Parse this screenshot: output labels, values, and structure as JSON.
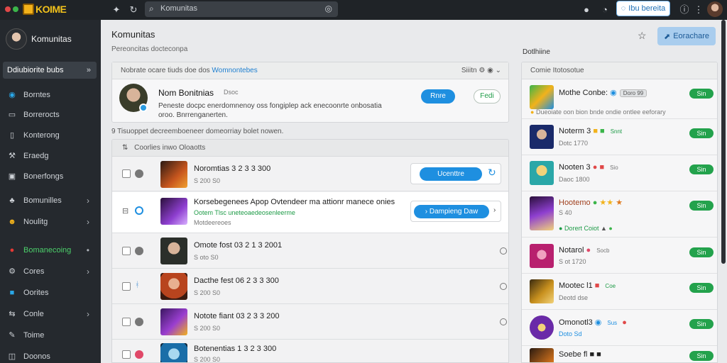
{
  "app": {
    "logo_text": "KOIME"
  },
  "topbar": {
    "search_text": "Komunitas",
    "button_label": "Ibu bereita",
    "icons": [
      "star-icon",
      "emoji-icon",
      "search-icon",
      "notification-icon",
      "settings-icon"
    ]
  },
  "sidebar": {
    "profile_name": "Komunitas",
    "active_label": "Ddiubiorite bubs",
    "items": [
      {
        "label": "Borntes",
        "icon": "layers-icon"
      },
      {
        "label": "Borrerocts",
        "icon": "monitor-icon"
      },
      {
        "label": "Konterong",
        "icon": "book-icon"
      },
      {
        "label": "Eraedg",
        "icon": "tools-icon"
      },
      {
        "label": "Bonerfongs",
        "icon": "image-icon"
      },
      {
        "label": "Bomunilles",
        "icon": "group-icon"
      },
      {
        "label": "Noulitg",
        "icon": "smile-icon"
      },
      {
        "label": "Bomanecoing",
        "icon": "heart-icon"
      },
      {
        "label": "Cores",
        "icon": "gear-icon"
      },
      {
        "label": "Oorites",
        "icon": "blue-square-icon"
      },
      {
        "label": "Conle",
        "icon": "arrows-icon"
      },
      {
        "label": "Toime",
        "icon": "pen-icon"
      },
      {
        "label": "Doonos",
        "icon": "chat-icon"
      }
    ]
  },
  "main": {
    "title": "Komunitas",
    "subtitle": "Pereoncitas docteconpa",
    "primary_button": "Eorachare",
    "panel_a": {
      "head_text": "Nobrate ocare tiuds doe dos",
      "head_highlight": "Womnontebes",
      "tools": "Siiitn",
      "name": "Nom Bonitnias",
      "tag": "Dsoc",
      "description": "Peneste docpc enerdomnenoy oss fongiplep ack enecoonrte onbosatia oroo. Bnrrenganerten.",
      "btn_blue": "Rnre",
      "btn_outline": "Fedi"
    },
    "section_note": "9 Tisuoppet decreemboeneer domeorriay bolet nowen.",
    "panel_b": {
      "head_text": "Coorlies inwo Oloaotts",
      "rows": [
        {
          "title": "Noromtias 3 2 3 3 300",
          "meta": "S 200 S0",
          "action": "Ucenttre"
        },
        {
          "title": "Korsebegenees Apop Ovtendeer ma attionr manece onies",
          "green": "Ootem Tlsc uneteoaedeosenleerme",
          "meta": "Motdeereoes",
          "action": "Dampieng Daw"
        },
        {
          "title": "Omote fost 03 2 1 3 2001",
          "meta": "S oto S0"
        },
        {
          "title": "Dacthe fest 06 2 3 3 300",
          "meta": "S 200 S0"
        },
        {
          "title": "Notote fiant 03 2 3 3 200",
          "meta": "S 200 S0"
        },
        {
          "title": "Botenentias 1 3 2 3 300",
          "meta": "S 200 S0"
        }
      ]
    }
  },
  "right": {
    "title": "Dotlhiine",
    "head_text": "Comie Itotosotue",
    "items": [
      {
        "name": "Mothe Conbe:",
        "tag": "Doro 99",
        "meta": "Dueoiate oon bion bnde ondie ontlee eeforary",
        "btn": "Sin"
      },
      {
        "name": "Noterm 3",
        "tag": "Snnt",
        "meta": "Dotc 1770",
        "btn": "Sin"
      },
      {
        "name": "Nooten 3",
        "tag": "Sio",
        "meta": "Daoc 1800",
        "btn": "Sin"
      },
      {
        "name": "Hootemo",
        "tag": "",
        "meta": "S 40",
        "sub": "Dorert Coiot",
        "btn": "Sin"
      },
      {
        "name": "Notarol",
        "tag": "Socb",
        "meta": "S ot 1720",
        "btn": "Sin"
      },
      {
        "name": "Mootec l1",
        "tag": "Coe",
        "meta": "Deotd dse",
        "btn": "Sin"
      },
      {
        "name": "Omonotl3",
        "tag": "Sus",
        "meta": "Doto Sd",
        "btn": "Sin"
      },
      {
        "name": "Soebe fl",
        "tag": "",
        "meta": "",
        "btn": "Sin"
      }
    ]
  },
  "colors": {
    "accent": "#1e8fe0",
    "green": "#23a24c",
    "sidebar": "#25292e"
  }
}
